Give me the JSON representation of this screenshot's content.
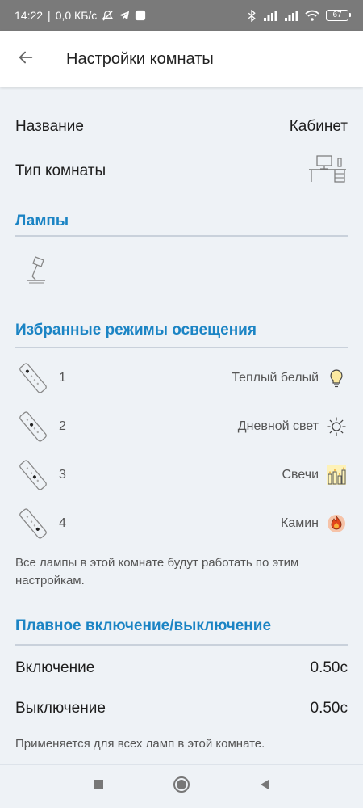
{
  "status_bar": {
    "time": "14:22",
    "speed": "0,0 КБ/с",
    "battery": "67",
    "icons": [
      "mute-alarm-icon",
      "telegram-icon",
      "app-icon",
      "bluetooth-icon",
      "signal-icon",
      "signal-icon",
      "wifi-icon",
      "battery-icon"
    ]
  },
  "app_bar": {
    "title": "Настройки комнаты",
    "back_icon": "arrow-left-icon"
  },
  "room": {
    "name_label": "Название",
    "name_value": "Кабинет",
    "type_label": "Тип комнаты",
    "type_icon": "office-desk-icon"
  },
  "lamps": {
    "title": "Лампы",
    "lamp_icon": "desk-lamp-icon"
  },
  "favorite_modes": {
    "title": "Избранные режимы освещения",
    "items": [
      {
        "number": "1",
        "name": "Теплый белый",
        "icon": "bulb-icon"
      },
      {
        "number": "2",
        "name": "Дневной свет",
        "icon": "sun-icon"
      },
      {
        "number": "3",
        "name": "Свечи",
        "icon": "candles-icon"
      },
      {
        "number": "4",
        "name": "Камин",
        "icon": "fire-icon"
      }
    ],
    "note": "Все лампы в этой комнате будут работать по этим настройкам."
  },
  "fade": {
    "title": "Плавное включение/выключение",
    "on_label": "Включение",
    "on_value": "0.50с",
    "off_label": "Выключение",
    "off_value": "0.50с",
    "note": "Применяется для всех ламп в этой комнате."
  },
  "nav_bar": {
    "icons": [
      "square-recents-icon",
      "circle-home-icon",
      "triangle-back-icon"
    ]
  },
  "colors": {
    "accent": "#1b84c4",
    "status_bar": "#7a7a7a",
    "background": "#eef2f6"
  }
}
